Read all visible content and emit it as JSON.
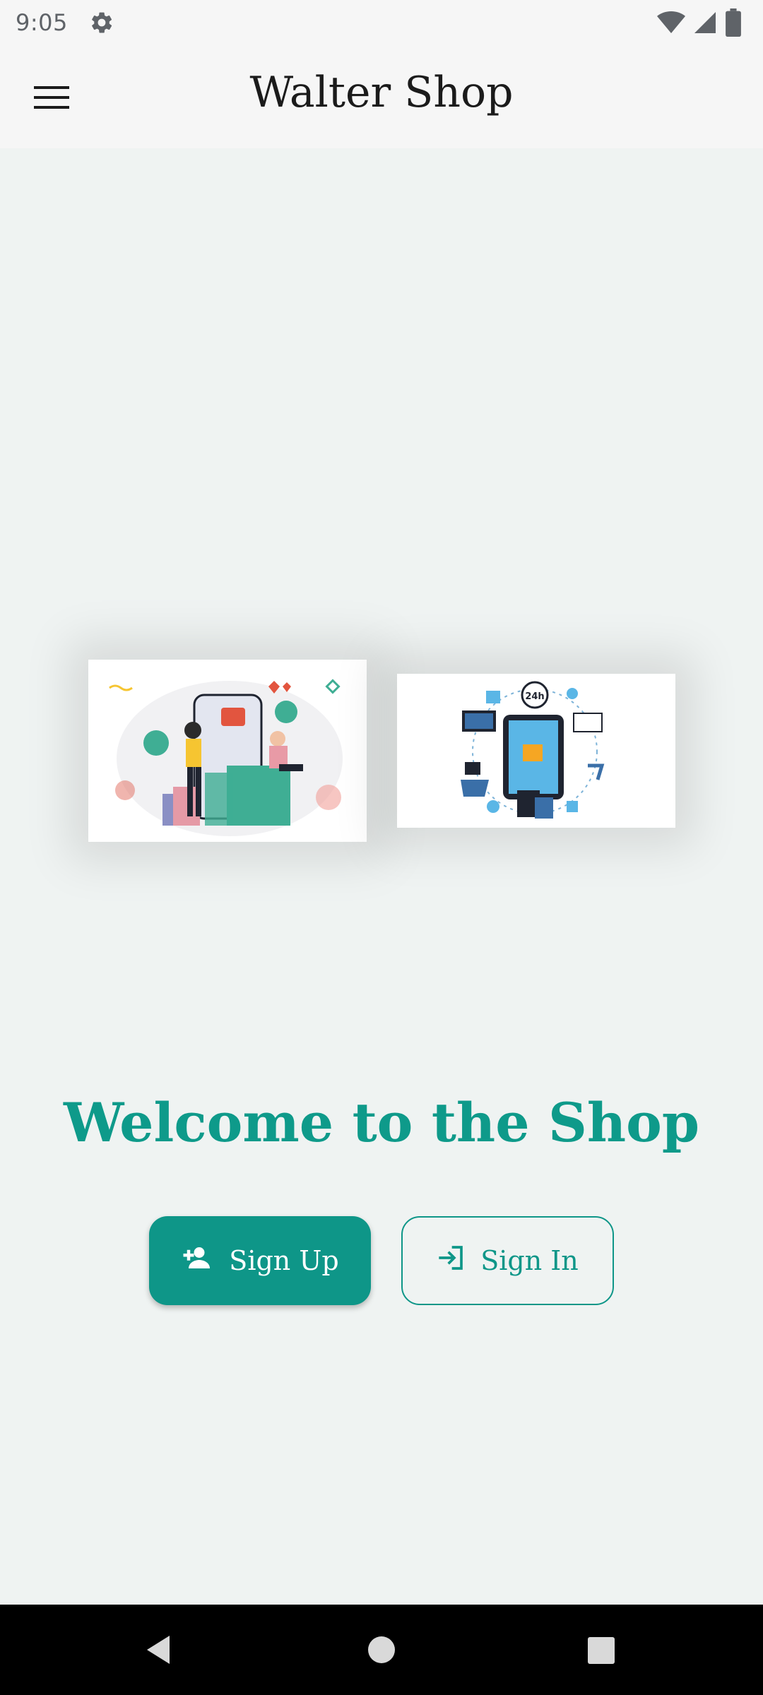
{
  "status_bar": {
    "time": "9:05",
    "icons": [
      "gear-icon",
      "wifi-icon",
      "signal-icon",
      "battery-icon"
    ]
  },
  "app_bar": {
    "title": "Walter Shop",
    "menu_icon": "hamburger-menu-icon"
  },
  "main": {
    "images": [
      {
        "name": "shopping-illustration-1",
        "description_icon": "online-shopping-image"
      },
      {
        "name": "shopping-illustration-2",
        "description_icon": "ecommerce-24h-image"
      }
    ],
    "welcome_text": "Welcome to the Shop",
    "buttons": {
      "sign_up": {
        "label": "Sign Up",
        "icon": "person-add-icon"
      },
      "sign_in": {
        "label": "Sign In",
        "icon": "login-icon"
      }
    }
  },
  "nav_bar": {
    "buttons": [
      "back-icon",
      "home-icon",
      "recents-icon"
    ]
  },
  "colors": {
    "accent": "#0e9688",
    "background": "#eff3f2",
    "app_bar": "#f6f6f6"
  }
}
